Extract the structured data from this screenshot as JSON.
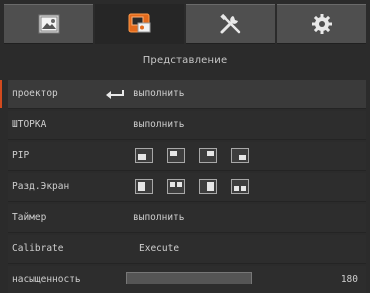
{
  "tabs": [
    {
      "name": "image-tab",
      "icon": "image-icon"
    },
    {
      "name": "setup-tab",
      "icon": "projector-setup-icon",
      "active": true
    },
    {
      "name": "tools-tab",
      "icon": "tools-icon"
    },
    {
      "name": "settings-tab",
      "icon": "gear-icon"
    }
  ],
  "section_title": "Представление",
  "rows": [
    {
      "label": "проектор",
      "value": "выполнить",
      "selected": true
    },
    {
      "label": "ШТОРКА",
      "value": "выполнить"
    },
    {
      "label": "PIP"
    },
    {
      "label": "Разд.Экран"
    },
    {
      "label": "Таймер",
      "value": "выполнить"
    },
    {
      "label": "Calibrate",
      "value": "Execute"
    },
    {
      "label": "насыщенность",
      "value": "180"
    }
  ],
  "pip_options": [
    "pip-top-left",
    "pip-top-center",
    "pip-top-right",
    "pip-bottom-right"
  ],
  "split_options": [
    "split-left-half",
    "split-top-two",
    "split-right-half",
    "split-bottom-two"
  ],
  "colors": {
    "accent": "#d24a1e",
    "background": "#2b2b2b"
  }
}
